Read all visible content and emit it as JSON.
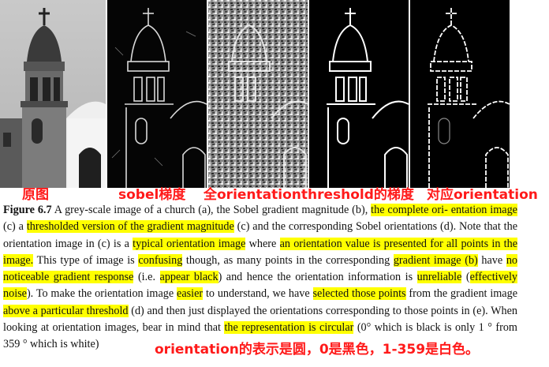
{
  "labels": {
    "original": "原图",
    "sobel": "sobel梯度",
    "full_threshold": "全orientationthreshold的梯度",
    "corresponding": "对应orientation"
  },
  "caption": {
    "fig": "Figure 6.7",
    "s01": " A grey-scale image of a church (a), the Sobel gradient magnitude (b), ",
    "h01": "the complete ori- entation image",
    "s02": " (c) a ",
    "h02": "thresholded version of the gradient magnitude",
    "s03": " (c) and the corresponding Sobel orientations (d). Note that the orientation image in (c) is a ",
    "h03": "typical orientation image",
    "s04": " where ",
    "h04": "an orientation value is presented for all points in the image.",
    "s05": " This type of image is ",
    "h05": "confusing",
    "s06": " though, as many points in the corresponding ",
    "h06": "gradient image (b)",
    "s07": " have ",
    "h07": "no noticeable gradient response",
    "s08": " (i.e. ",
    "h08": "appear black",
    "s09": ") and hence the orientation information is ",
    "h09": "unreliable",
    "s10": " (",
    "h10": "effectively noise",
    "s11": "). To make the orientation image ",
    "h11": "easier",
    "s12": " to understand, we have ",
    "h12": "selected those points",
    "s13": " from the gradient image ",
    "h13": "above a particular threshold",
    "s14": " (d) and then just displayed the orientations corresponding to those points in (e). When looking at orientation images, bear in mind that ",
    "h14": "the representation is circular",
    "s15": " (0° which is black is only 1 ° from 359 ° which is white)"
  },
  "note": "orientation的表示是圆，0是黑色，1-359是白色。",
  "colors": {
    "annotation": "#ff1a1a",
    "highlight": "#ffff00"
  }
}
